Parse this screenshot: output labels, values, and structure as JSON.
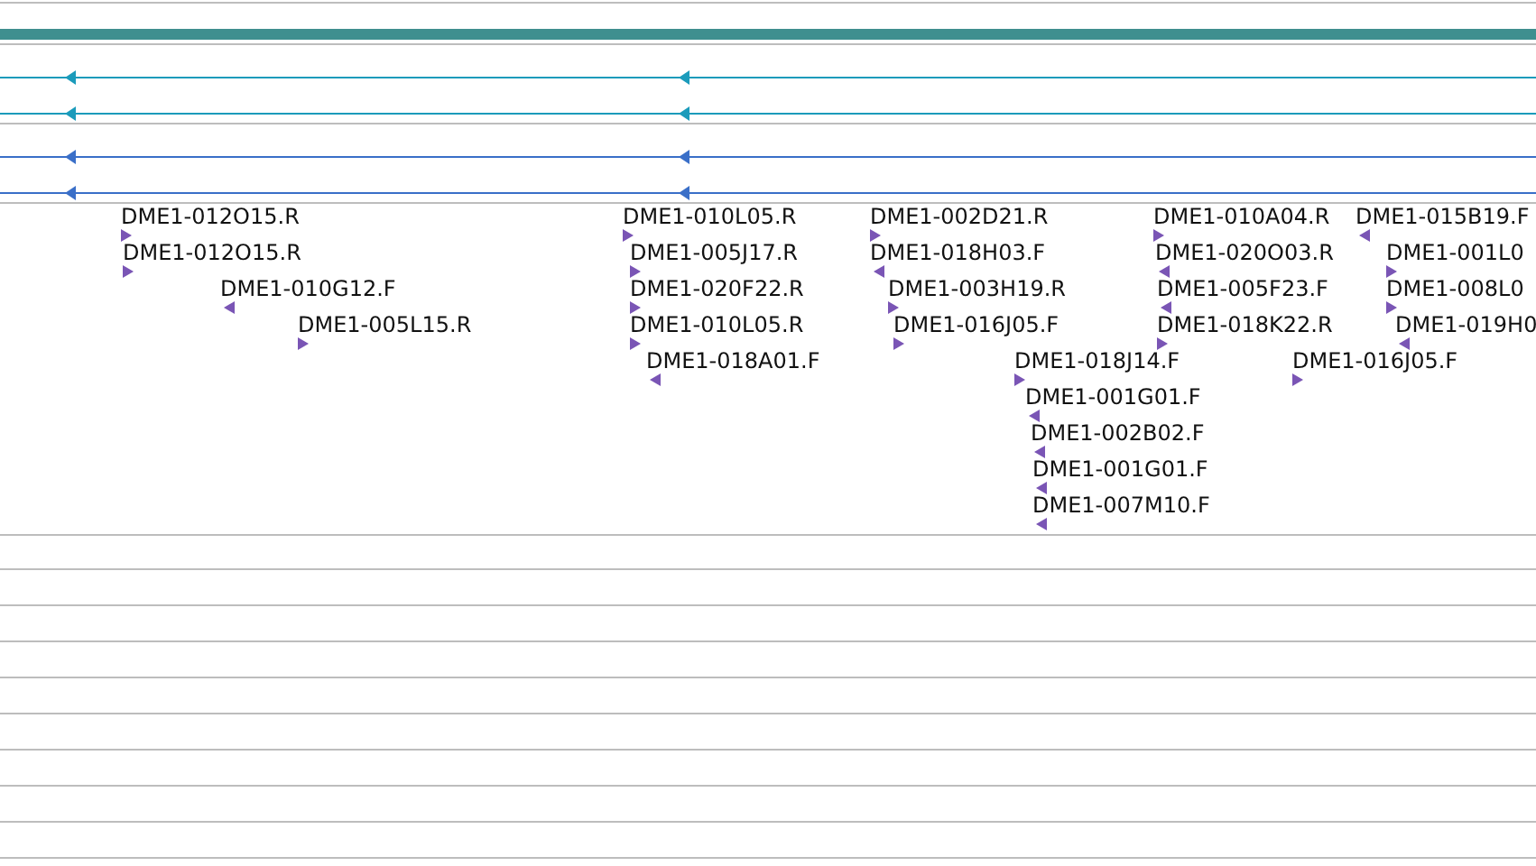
{
  "coverage_track": {
    "color": "#3f8f8f"
  },
  "alignment_tracks": [
    {
      "color": "#1b9bbb",
      "reverse": true
    },
    {
      "color": "#1b9bbb",
      "reverse": true
    },
    {
      "color": "#3a6fc8",
      "reverse": true
    },
    {
      "color": "#3a6fc8",
      "reverse": true
    }
  ],
  "features": [
    {
      "label": "DME1-012O15.R",
      "reverse": false
    },
    {
      "label": "DME1-012O15.R",
      "reverse": false
    },
    {
      "label": "DME1-010G12.F",
      "reverse": true
    },
    {
      "label": "DME1-005L15.R",
      "reverse": false
    },
    {
      "label": "DME1-010L05.R",
      "reverse": false
    },
    {
      "label": "DME1-005J17.R",
      "reverse": false
    },
    {
      "label": "DME1-020F22.R",
      "reverse": false
    },
    {
      "label": "DME1-010L05.R",
      "reverse": false
    },
    {
      "label": "DME1-018A01.F",
      "reverse": true
    },
    {
      "label": "DME1-002D21.R",
      "reverse": false
    },
    {
      "label": "DME1-018H03.F",
      "reverse": true
    },
    {
      "label": "DME1-003H19.R",
      "reverse": false
    },
    {
      "label": "DME1-016J05.F",
      "reverse": false
    },
    {
      "label": "DME1-018J14.F",
      "reverse": false
    },
    {
      "label": "DME1-001G01.F",
      "reverse": true
    },
    {
      "label": "DME1-002B02.F",
      "reverse": true
    },
    {
      "label": "DME1-001G01.F",
      "reverse": true
    },
    {
      "label": "DME1-007M10.F",
      "reverse": true
    },
    {
      "label": "DME1-010A04.R",
      "reverse": false
    },
    {
      "label": "DME1-020O03.R",
      "reverse": true
    },
    {
      "label": "DME1-005F23.F",
      "reverse": true
    },
    {
      "label": "DME1-018K22.R",
      "reverse": false
    },
    {
      "label": "DME1-016J05.F",
      "reverse": false
    },
    {
      "label": "DME1-015B19.F",
      "reverse": true
    },
    {
      "label": "DME1-001L0",
      "reverse": false
    },
    {
      "label": "DME1-008L0",
      "reverse": false
    },
    {
      "label": "DME1-019H0",
      "reverse": true
    }
  ]
}
